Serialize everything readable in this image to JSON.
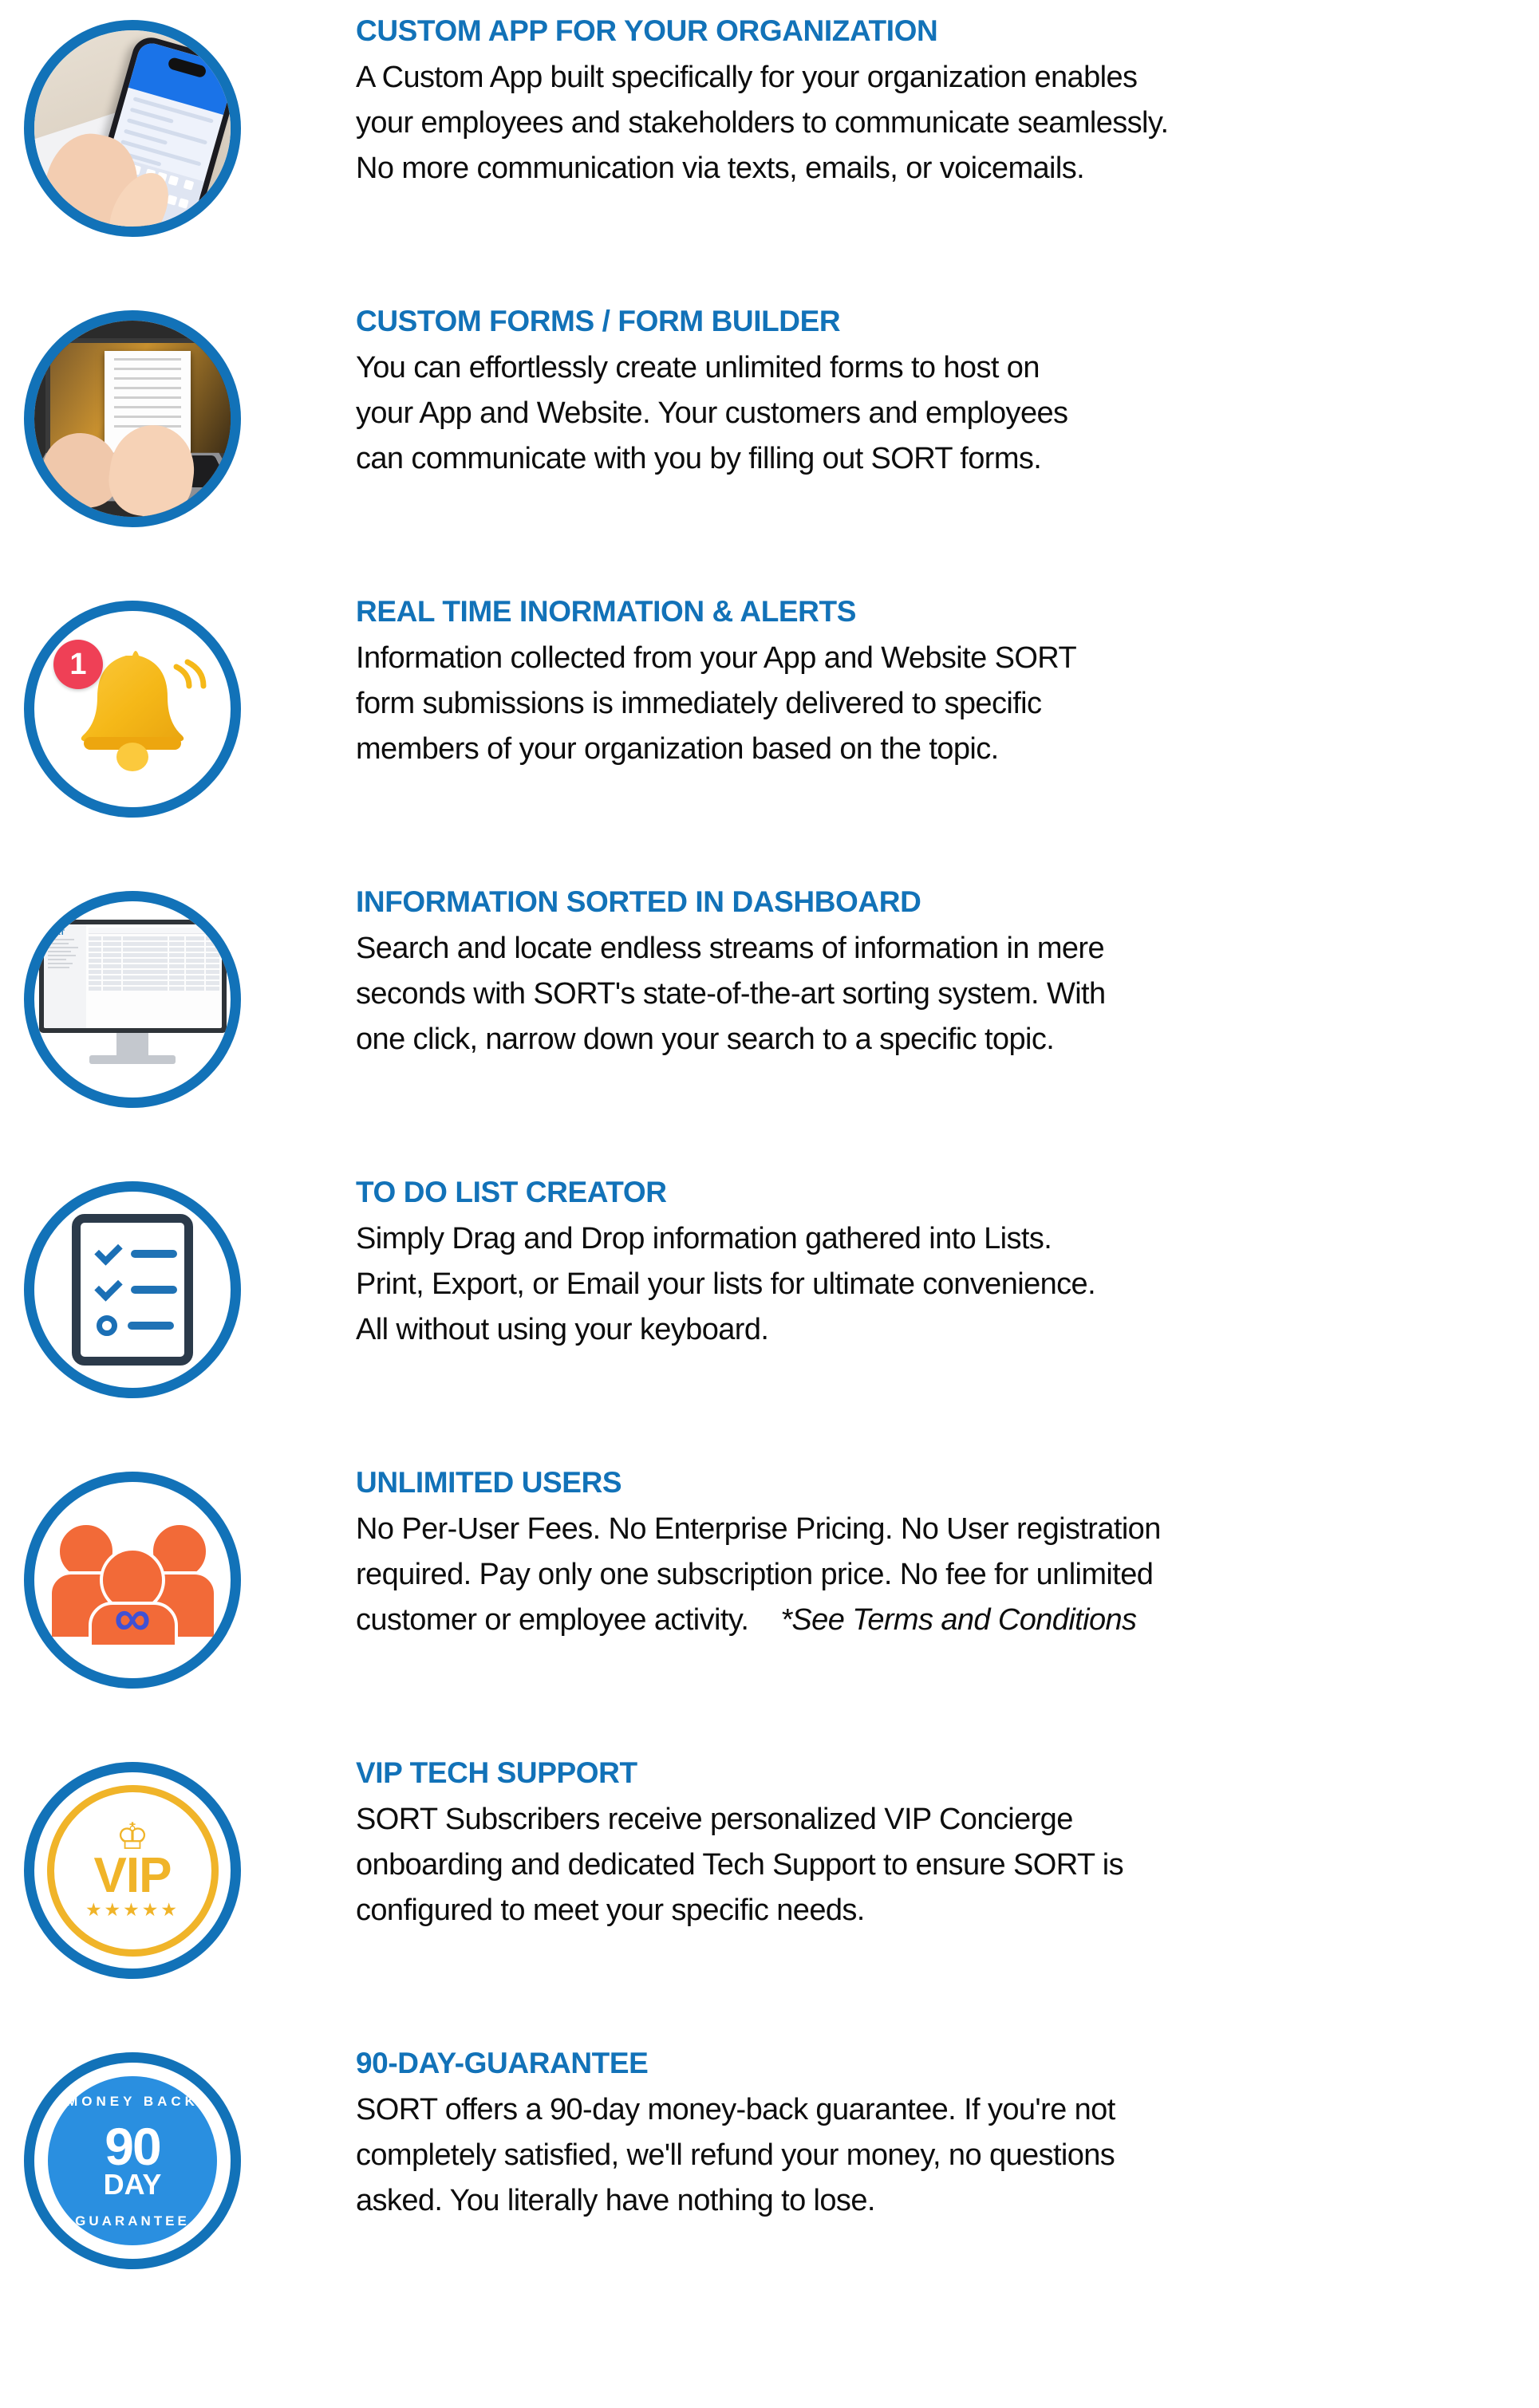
{
  "theme": {
    "heading_color": "#1272b8",
    "ring_color": "#1272b8",
    "body_color": "#0d0d0d",
    "accent_orange": "#f26a38",
    "accent_gold": "#f0b429",
    "accent_red": "#ef4056",
    "background": "#ffffff"
  },
  "features": [
    {
      "icon": "phone-photo-icon",
      "heading": "CUSTOM APP FOR YOUR ORGANIZATION",
      "body_lines": [
        "A Custom App built specifically for your organization enables",
        "your employees and stakeholders to communicate seamlessly.",
        "No more communication via texts, emails, or voicemails."
      ]
    },
    {
      "icon": "laptop-photo-icon",
      "heading": "CUSTOM FORMS / FORM BUILDER",
      "body_lines": [
        "You can effortlessly create unlimited forms to host on",
        "your App and Website. Your customers and employees",
        "can communicate with you by filling out SORT forms."
      ]
    },
    {
      "icon": "bell-notification-icon",
      "heading": "REAL TIME INORMATION & ALERTS",
      "badge_count": "1",
      "body_lines": [
        "Information collected from your App and Website SORT",
        "form submissions is immediately delivered to specific",
        "members of your organization based on the topic."
      ]
    },
    {
      "icon": "monitor-dashboard-icon",
      "heading": "INFORMATION SORTED IN DASHBOARD",
      "screen_logo": "SORT",
      "body_lines": [
        "Search and locate endless streams of information in mere",
        "seconds with SORT's state-of-the-art sorting system. With",
        "one click, narrow down your search to a specific topic."
      ]
    },
    {
      "icon": "checklist-clipboard-icon",
      "heading": "TO DO LIST CREATOR",
      "body_lines": [
        "Simply Drag and Drop information gathered into Lists.",
        "Print, Export, or Email your lists for ultimate convenience.",
        "All without using your keyboard."
      ]
    },
    {
      "icon": "users-infinity-icon",
      "heading": "UNLIMITED USERS",
      "infinity_symbol": "∞",
      "body_lines": [
        "No Per-User Fees. No Enterprise Pricing. No User registration",
        "required. Pay only one subscription price. No fee for unlimited",
        "customer or employee activity."
      ],
      "body_italic_suffix": "*See Terms and Conditions"
    },
    {
      "icon": "vip-badge-icon",
      "heading": "VIP TECH SUPPORT",
      "vip_label": "VIP",
      "vip_crown": "♔",
      "vip_stars": "★★★★★",
      "body_lines": [
        "SORT Subscribers receive personalized VIP Concierge",
        "onboarding and dedicated Tech Support to ensure SORT is",
        "configured to meet your specific needs."
      ]
    },
    {
      "icon": "money-back-seal-icon",
      "heading": "90-DAY-GUARANTEE",
      "seal_top_text": "MONEY BACK",
      "seal_number": "90",
      "seal_day": "DAY",
      "seal_bottom_text": "GUARANTEE",
      "body_lines": [
        "SORT offers a 90-day money-back guarantee. If you're not",
        "completely satisfied, we'll refund your money, no questions",
        "asked.  You literally have nothing to lose."
      ]
    }
  ]
}
